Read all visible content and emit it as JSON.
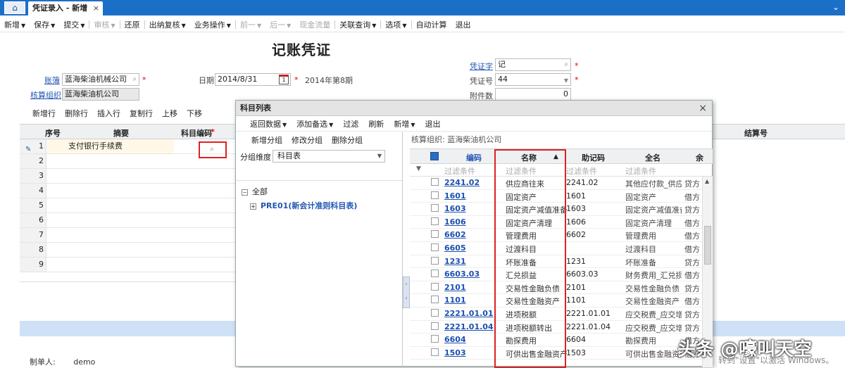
{
  "tabs": {
    "active_label": "凭证录入 - 新增",
    "close": "×",
    "menu_icon": "chevron-double-down"
  },
  "toolbar": {
    "items": [
      {
        "label": "新增",
        "dropdown": true,
        "disabled": false
      },
      {
        "label": "保存",
        "dropdown": true,
        "disabled": false
      },
      {
        "label": "提交",
        "dropdown": true,
        "disabled": false
      },
      {
        "label": "审核",
        "dropdown": true,
        "disabled": true
      },
      {
        "label": "还原",
        "dropdown": false,
        "disabled": false
      },
      {
        "label": "出纳复核",
        "dropdown": true,
        "disabled": false
      },
      {
        "label": "业务操作",
        "dropdown": true,
        "disabled": false
      },
      {
        "label": "前一",
        "dropdown": true,
        "disabled": true
      },
      {
        "label": "后一",
        "dropdown": true,
        "disabled": true
      },
      {
        "label": "现金流量",
        "dropdown": false,
        "disabled": true
      },
      {
        "label": "关联查询",
        "dropdown": true,
        "disabled": false
      },
      {
        "label": "选项",
        "dropdown": true,
        "disabled": false
      },
      {
        "label": "自动计算",
        "dropdown": false,
        "disabled": false
      },
      {
        "label": "退出",
        "dropdown": false,
        "disabled": false
      }
    ]
  },
  "page_title": "记账凭证",
  "form": {
    "ledger_label": "账簿",
    "ledger_value": "蓝海柴油机械公司",
    "org_label": "核算组织",
    "org_value": "蓝海柴油机公司",
    "date_label": "日期",
    "date_value": "2014/8/31",
    "period": "2014年第8期",
    "voucher_word_label": "凭证字",
    "voucher_word_value": "记",
    "voucher_no_label": "凭证号",
    "voucher_no_value": "44",
    "attachments_label": "附件数",
    "attachments_value": "0",
    "required_mark": "*"
  },
  "entry_toolbar": [
    "新增行",
    "删除行",
    "插入行",
    "复制行",
    "上移",
    "下移"
  ],
  "entry_grid": {
    "headers": {
      "seq": "序号",
      "summary": "摘要",
      "account_code": "科目编码",
      "settlement_no": "结算号"
    },
    "rows": [
      {
        "seq": "1",
        "summary": "支付银行手续费"
      },
      {
        "seq": "2",
        "summary": ""
      },
      {
        "seq": "3",
        "summary": ""
      },
      {
        "seq": "4",
        "summary": ""
      },
      {
        "seq": "5",
        "summary": ""
      },
      {
        "seq": "6",
        "summary": ""
      },
      {
        "seq": "7",
        "summary": ""
      },
      {
        "seq": "8",
        "summary": ""
      },
      {
        "seq": "9",
        "summary": ""
      }
    ]
  },
  "maker": {
    "label": "制单人:",
    "value": "demo"
  },
  "dialog": {
    "title": "科目列表",
    "close": "×",
    "toolbar": [
      {
        "label": "返回数据",
        "dropdown": true
      },
      {
        "label": "添加备选",
        "dropdown": true
      },
      {
        "label": "过滤",
        "dropdown": false
      },
      {
        "label": "刷新",
        "dropdown": false
      },
      {
        "label": "新增",
        "dropdown": true
      },
      {
        "label": "退出",
        "dropdown": false
      }
    ],
    "left": {
      "toolbar": [
        "新增分组",
        "修改分组",
        "删除分组"
      ],
      "group_dim_label": "分组维度",
      "group_dim_value": "科目表",
      "tree_root": "全部",
      "tree_child": "PRE01(新会计准则科目表)"
    },
    "right": {
      "org_line": "核算组织:  蓝海柴油机公司",
      "headers": {
        "code": "编码",
        "name": "名称",
        "mnemonic": "助记码",
        "fullname": "全名",
        "dir": "余"
      },
      "filter_placeholder": "过滤条件",
      "rows": [
        {
          "code": "2241.02",
          "name": "供应商往来",
          "mnemonic": "2241.02",
          "fullname": "其他应付款_供应商",
          "dir": "贷方"
        },
        {
          "code": "1601",
          "name": "固定资产",
          "mnemonic": "1601",
          "fullname": "固定资产",
          "dir": "借方"
        },
        {
          "code": "1603",
          "name": "固定资产减值准备",
          "mnemonic": "1603",
          "fullname": "固定资产减值准备",
          "dir": "贷方"
        },
        {
          "code": "1606",
          "name": "固定资产清理",
          "mnemonic": "1606",
          "fullname": "固定资产清理",
          "dir": "借方"
        },
        {
          "code": "6602",
          "name": "管理费用",
          "mnemonic": "6602",
          "fullname": "管理费用",
          "dir": "借方"
        },
        {
          "code": "6605",
          "name": "过渡科目",
          "mnemonic": "",
          "fullname": "过渡科目",
          "dir": "借方"
        },
        {
          "code": "1231",
          "name": "坏账准备",
          "mnemonic": "1231",
          "fullname": "坏账准备",
          "dir": "贷方"
        },
        {
          "code": "6603.03",
          "name": "汇兑损益",
          "mnemonic": "6603.03",
          "fullname": "财务费用_汇兑损益",
          "dir": "借方"
        },
        {
          "code": "2101",
          "name": "交易性金融负债",
          "mnemonic": "2101",
          "fullname": "交易性金融负债",
          "dir": "贷方"
        },
        {
          "code": "1101",
          "name": "交易性金融资产",
          "mnemonic": "1101",
          "fullname": "交易性金融资产",
          "dir": "借方"
        },
        {
          "code": "2221.01.01",
          "name": "进项税额",
          "mnemonic": "2221.01.01",
          "fullname": "应交税费_应交增值",
          "dir": "贷方"
        },
        {
          "code": "2221.01.04",
          "name": "进项税额转出",
          "mnemonic": "2221.01.04",
          "fullname": "应交税费_应交增值",
          "dir": "贷方"
        },
        {
          "code": "6604",
          "name": "勘探费用",
          "mnemonic": "6604",
          "fullname": "勘探费用",
          "dir": "借方"
        },
        {
          "code": "1503",
          "name": "可供出售金融资产",
          "mnemonic": "1503",
          "fullname": "可供出售金融资产",
          "dir": "借方"
        }
      ]
    }
  },
  "watermark": "头条 @嚎叫天空",
  "activate_hint": "转到\"设置\"以激活 Windows。",
  "colors": {
    "tabbar": "#1c6fc7",
    "link": "#2256b3",
    "highlight_box": "#dd2222",
    "status_bar": "#cfe1f7"
  }
}
